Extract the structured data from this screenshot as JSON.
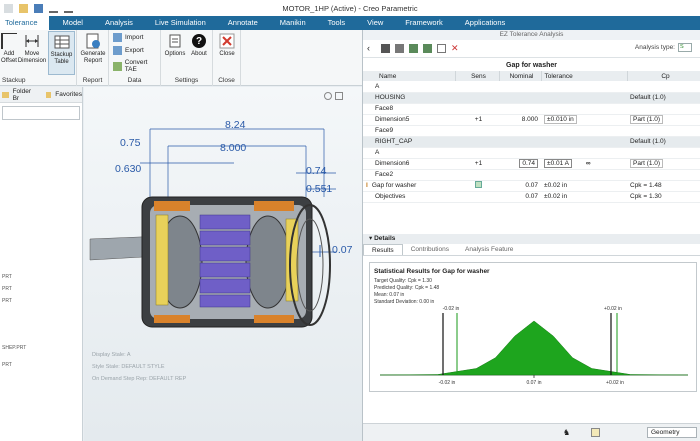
{
  "window": {
    "title": "MOTOR_1HP (Active) - Creo Parametric"
  },
  "tabs": [
    {
      "label": "Tolerance",
      "active": true
    },
    {
      "label": "Model"
    },
    {
      "label": "Analysis"
    },
    {
      "label": "Live Simulation"
    },
    {
      "label": "Annotate"
    },
    {
      "label": "Manikin"
    },
    {
      "label": "Tools"
    },
    {
      "label": "View"
    },
    {
      "label": "Framework"
    },
    {
      "label": "Applications"
    }
  ],
  "ribbon": {
    "stackup_group": "Stackup",
    "btn_add_offset": "Add\nOffset",
    "btn_move_dimension": "Move\nDimension",
    "btn_stackup_table": "Stackup\nTable",
    "report_group": "Report",
    "btn_generate_report": "Generate\nReport",
    "data_group": "Data",
    "btn_import": "Import",
    "btn_export": "Export",
    "btn_convert": "Convert TAE",
    "settings_group": "Settings",
    "btn_options": "Options",
    "btn_about": "About",
    "close_group": "Close",
    "btn_close": "Close"
  },
  "tree": {
    "folder_tab": "Folder Br",
    "favorites_tab": "Favorites",
    "items": [
      "PRT",
      "PRT",
      "PRT",
      "SHEP.PRT",
      "PRT"
    ]
  },
  "graphics": {
    "dims": [
      "8.24",
      "0.75",
      "8.000",
      "0.630",
      "0.74",
      "0.551",
      "0.07"
    ],
    "notes": [
      "Display Stale: A",
      "Style Stale: DEFAULT STYLE",
      "On Demand Step Rep: DEFAULT REP"
    ]
  },
  "ez": {
    "header": "EZ Tolerance Analysis",
    "analysis_type_label": "Analysis type:",
    "analysis_type_value": "S",
    "gap_title": "Gap for washer",
    "columns": [
      "Name",
      "Sens",
      "Nominal",
      "Tolerance",
      "Cp"
    ],
    "rows": [
      {
        "kind": "plain",
        "name": "A"
      },
      {
        "kind": "section",
        "name": "HOUSING",
        "cp": "Default (1.0)"
      },
      {
        "kind": "plain",
        "name": "Face8"
      },
      {
        "kind": "dim",
        "name": "Dimension5",
        "sens": "+1",
        "nominal": "8.000",
        "tolerance": "±0.010 in",
        "cp": "Part (1.0)"
      },
      {
        "kind": "plain",
        "name": "Face9"
      },
      {
        "kind": "section",
        "name": "RIGHT_CAP",
        "cp": "Default (1.0)"
      },
      {
        "kind": "plain",
        "name": "A"
      },
      {
        "kind": "dim2",
        "name": "Dimension6",
        "sens": "+1",
        "nominal": "0.74",
        "tolerance": "±0.01 A",
        "cp": "Part (1.0)"
      },
      {
        "kind": "plain",
        "name": "Face2"
      },
      {
        "kind": "result",
        "name": "Gap for washer",
        "nominal": "0.07",
        "tolerance": "±0.02 in",
        "cp": "Cpk = 1.48"
      },
      {
        "kind": "result",
        "name": "Objectives",
        "nominal": "0.07",
        "tolerance": "±0.02 in",
        "cp": "Cpk = 1.30"
      }
    ],
    "details_label": "Details",
    "detail_tabs": [
      "Results",
      "Contributions",
      "Analysis Feature"
    ],
    "results": {
      "title": "Statistical Results for Gap for washer",
      "lines": [
        "Target Quality: Cpk = 1.30",
        "Predicted Quality: Cpk = 1.48",
        "Mean: 0.07 in",
        "Standard Deviation: 0.00 in"
      ],
      "top_labels": [
        "-0.02 in",
        "+0.02 in"
      ],
      "bottom_labels": [
        "-0.02 in",
        "0.07 in",
        "+0.02 in"
      ]
    },
    "status_geometry": "Geometry"
  },
  "chart_data": {
    "type": "area",
    "title": "Statistical Results for Gap for washer",
    "distribution": "normal",
    "mean": 0.07,
    "lower_limit": 0.05,
    "upper_limit": 0.09,
    "x": [
      0.03,
      0.045,
      0.055,
      0.06,
      0.065,
      0.07,
      0.075,
      0.08,
      0.085,
      0.095,
      0.11
    ],
    "y": [
      0.0,
      0.01,
      0.12,
      0.32,
      0.72,
      1.0,
      0.72,
      0.32,
      0.12,
      0.01,
      0.0
    ],
    "colors": {
      "fill": "#1ea51e",
      "limit_line": "#1a9a1a",
      "spec_line": "#111111"
    }
  }
}
